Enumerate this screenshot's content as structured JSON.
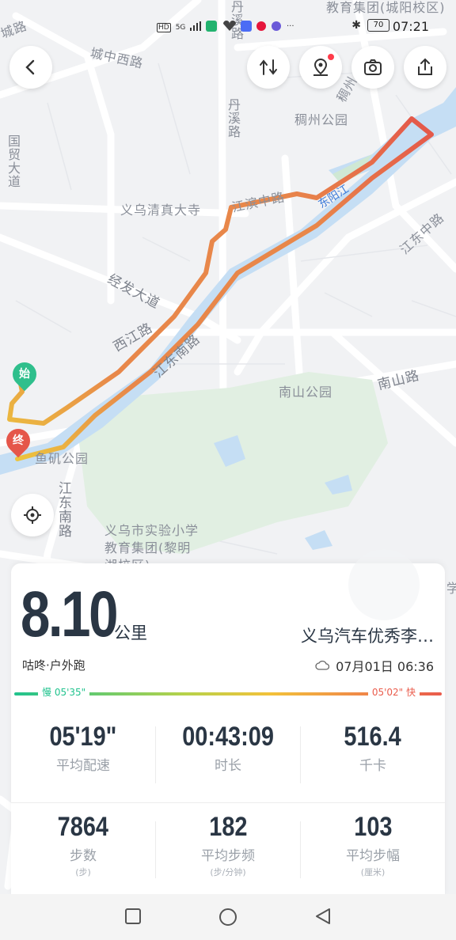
{
  "status_bar": {
    "time": "07:21",
    "battery": "70",
    "icons": [
      "HD",
      "5G",
      "signal",
      "wifi"
    ]
  },
  "map": {
    "labels": {
      "chengzhong_west": "城中西路",
      "danxi_top": "丹溪路",
      "danxi_mid": "丹溪路",
      "chouzhou_park": "稠州公园",
      "chouzhou_road": "稠州",
      "yiwu_mosque": "义乌清真大寺",
      "jiangbin_middle": "江滨中路",
      "dongyang_river": "东阳江",
      "jiangdong_middle": "江东中路",
      "jingfa_avenue": "经发大道",
      "xijiang_road": "西江路",
      "jiangnan_road": "江东南路",
      "nanshan_park": "南山公园",
      "nanshan_road": "南山路",
      "jiangdongnan_road_vert": "江东南路",
      "park_sw": "鱼矶公园",
      "school": "义乌市实验小学教育集团(黎明湖校区)",
      "school_top": "教育集团(城阳校区)",
      "cheng_road": "城路",
      "guo_road": "国贸大道",
      "right_edge": "学"
    },
    "start_marker": "始",
    "end_marker": "终"
  },
  "buttons": {
    "back": "back",
    "route": "route",
    "poi": "poi",
    "camera": "camera",
    "share": "share",
    "locate": "locate"
  },
  "summary": {
    "distance": "8.10",
    "unit": "公里",
    "route_name": "义乌汽车优秀李…",
    "activity": "咕咚·户外跑",
    "date": "07月01日 06:36"
  },
  "pace_bar": {
    "slow_label": "慢 05'35\"",
    "fast_label": "05'02\" 快"
  },
  "stats": [
    {
      "value": "05'19\"",
      "label": "平均配速",
      "sub": ""
    },
    {
      "value": "00:43:09",
      "label": "时长",
      "sub": ""
    },
    {
      "value": "516.4",
      "label": "千卡",
      "sub": ""
    },
    {
      "value": "7864",
      "label": "步数",
      "sub": "(步)"
    },
    {
      "value": "182",
      "label": "平均步频",
      "sub": "(步/分钟)"
    },
    {
      "value": "103",
      "label": "平均步幅",
      "sub": "(厘米)"
    }
  ],
  "colors": {
    "route_start": "#e8874a",
    "route_end": "#e4564a",
    "river": "#c5def4",
    "park": "#e1efe2",
    "text_dark": "#2a3644",
    "pace_slow": "#21c38e",
    "pace_fast": "#ea5c4c"
  }
}
